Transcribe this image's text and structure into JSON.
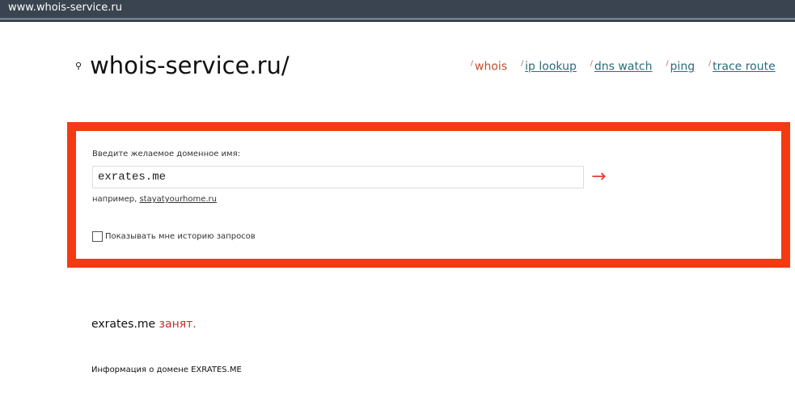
{
  "browser": {
    "url": "www.whois-service.ru"
  },
  "header": {
    "logo": "whois-service.ru/",
    "nav": [
      "whois",
      "ip lookup",
      "dns watch",
      "ping",
      "trace route"
    ]
  },
  "form": {
    "label": "Введите желаемое доменное имя:",
    "value": "exrates.me",
    "example_prefix": "например,",
    "example_link": "stayatyourhome.ru",
    "submit": "→",
    "history_label": "Показывать мне историю запросов"
  },
  "result": {
    "domain": "exrates.me",
    "status": "занят.",
    "info": "Информация о домене EXRATES.ME"
  }
}
